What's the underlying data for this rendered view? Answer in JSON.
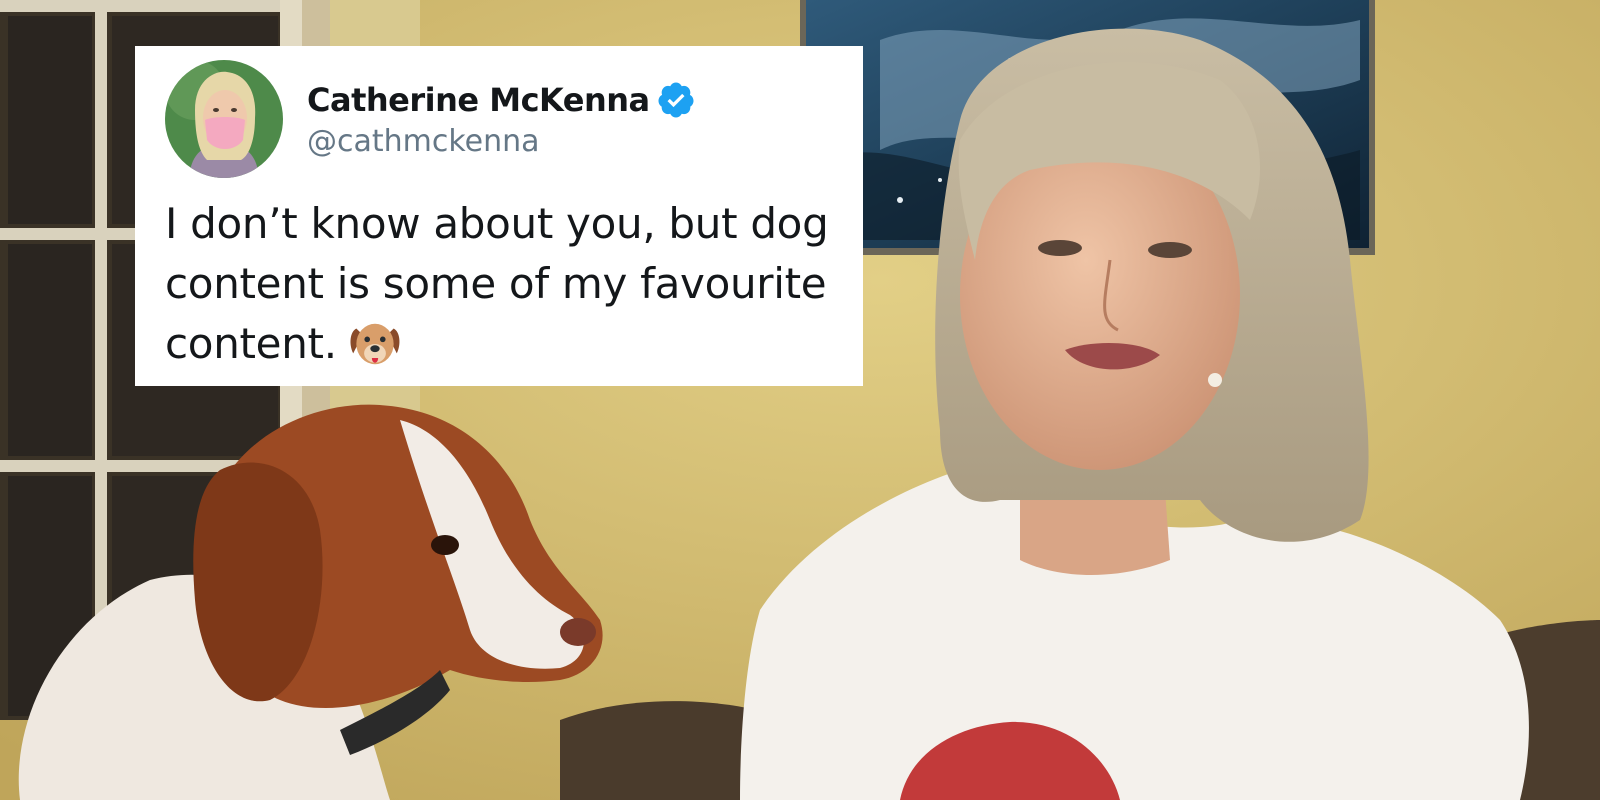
{
  "tweet": {
    "display_name": "Catherine McKenna",
    "handle": "@cathmckenna",
    "text": "I don’t know about you, but dog content is some of my favourite content.",
    "verified_color": "#1da1f2",
    "emoji_icon": "dog-face-emoji-icon"
  },
  "colors": {
    "wall": "#d9c47a",
    "card_bg": "#ffffff",
    "text_primary": "#14171a",
    "text_secondary": "#657786"
  }
}
